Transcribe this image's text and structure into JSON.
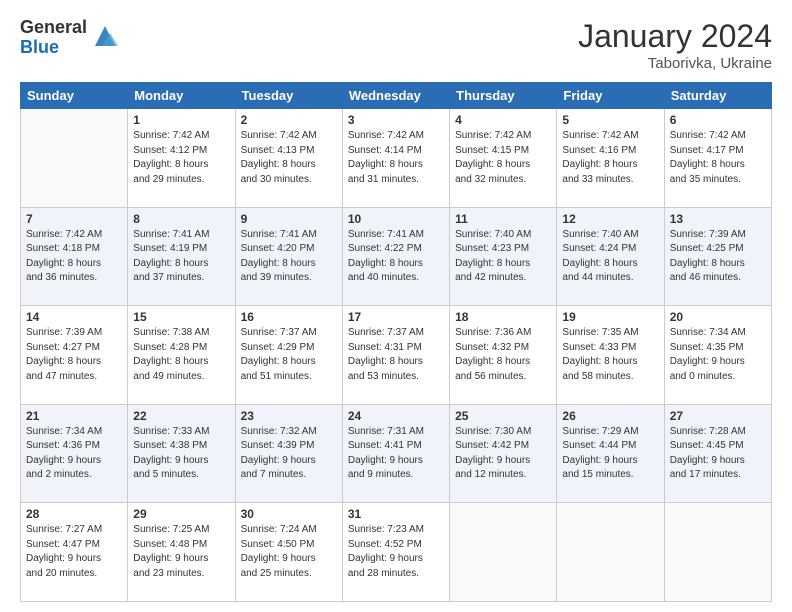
{
  "header": {
    "logo_general": "General",
    "logo_blue": "Blue",
    "month_year": "January 2024",
    "location": "Taborivka, Ukraine"
  },
  "columns": [
    "Sunday",
    "Monday",
    "Tuesday",
    "Wednesday",
    "Thursday",
    "Friday",
    "Saturday"
  ],
  "weeks": [
    {
      "shade": false,
      "days": [
        {
          "num": "",
          "info": ""
        },
        {
          "num": "1",
          "info": "Sunrise: 7:42 AM\nSunset: 4:12 PM\nDaylight: 8 hours\nand 29 minutes."
        },
        {
          "num": "2",
          "info": "Sunrise: 7:42 AM\nSunset: 4:13 PM\nDaylight: 8 hours\nand 30 minutes."
        },
        {
          "num": "3",
          "info": "Sunrise: 7:42 AM\nSunset: 4:14 PM\nDaylight: 8 hours\nand 31 minutes."
        },
        {
          "num": "4",
          "info": "Sunrise: 7:42 AM\nSunset: 4:15 PM\nDaylight: 8 hours\nand 32 minutes."
        },
        {
          "num": "5",
          "info": "Sunrise: 7:42 AM\nSunset: 4:16 PM\nDaylight: 8 hours\nand 33 minutes."
        },
        {
          "num": "6",
          "info": "Sunrise: 7:42 AM\nSunset: 4:17 PM\nDaylight: 8 hours\nand 35 minutes."
        }
      ]
    },
    {
      "shade": true,
      "days": [
        {
          "num": "7",
          "info": "Sunrise: 7:42 AM\nSunset: 4:18 PM\nDaylight: 8 hours\nand 36 minutes."
        },
        {
          "num": "8",
          "info": "Sunrise: 7:41 AM\nSunset: 4:19 PM\nDaylight: 8 hours\nand 37 minutes."
        },
        {
          "num": "9",
          "info": "Sunrise: 7:41 AM\nSunset: 4:20 PM\nDaylight: 8 hours\nand 39 minutes."
        },
        {
          "num": "10",
          "info": "Sunrise: 7:41 AM\nSunset: 4:22 PM\nDaylight: 8 hours\nand 40 minutes."
        },
        {
          "num": "11",
          "info": "Sunrise: 7:40 AM\nSunset: 4:23 PM\nDaylight: 8 hours\nand 42 minutes."
        },
        {
          "num": "12",
          "info": "Sunrise: 7:40 AM\nSunset: 4:24 PM\nDaylight: 8 hours\nand 44 minutes."
        },
        {
          "num": "13",
          "info": "Sunrise: 7:39 AM\nSunset: 4:25 PM\nDaylight: 8 hours\nand 46 minutes."
        }
      ]
    },
    {
      "shade": false,
      "days": [
        {
          "num": "14",
          "info": "Sunrise: 7:39 AM\nSunset: 4:27 PM\nDaylight: 8 hours\nand 47 minutes."
        },
        {
          "num": "15",
          "info": "Sunrise: 7:38 AM\nSunset: 4:28 PM\nDaylight: 8 hours\nand 49 minutes."
        },
        {
          "num": "16",
          "info": "Sunrise: 7:37 AM\nSunset: 4:29 PM\nDaylight: 8 hours\nand 51 minutes."
        },
        {
          "num": "17",
          "info": "Sunrise: 7:37 AM\nSunset: 4:31 PM\nDaylight: 8 hours\nand 53 minutes."
        },
        {
          "num": "18",
          "info": "Sunrise: 7:36 AM\nSunset: 4:32 PM\nDaylight: 8 hours\nand 56 minutes."
        },
        {
          "num": "19",
          "info": "Sunrise: 7:35 AM\nSunset: 4:33 PM\nDaylight: 8 hours\nand 58 minutes."
        },
        {
          "num": "20",
          "info": "Sunrise: 7:34 AM\nSunset: 4:35 PM\nDaylight: 9 hours\nand 0 minutes."
        }
      ]
    },
    {
      "shade": true,
      "days": [
        {
          "num": "21",
          "info": "Sunrise: 7:34 AM\nSunset: 4:36 PM\nDaylight: 9 hours\nand 2 minutes."
        },
        {
          "num": "22",
          "info": "Sunrise: 7:33 AM\nSunset: 4:38 PM\nDaylight: 9 hours\nand 5 minutes."
        },
        {
          "num": "23",
          "info": "Sunrise: 7:32 AM\nSunset: 4:39 PM\nDaylight: 9 hours\nand 7 minutes."
        },
        {
          "num": "24",
          "info": "Sunrise: 7:31 AM\nSunset: 4:41 PM\nDaylight: 9 hours\nand 9 minutes."
        },
        {
          "num": "25",
          "info": "Sunrise: 7:30 AM\nSunset: 4:42 PM\nDaylight: 9 hours\nand 12 minutes."
        },
        {
          "num": "26",
          "info": "Sunrise: 7:29 AM\nSunset: 4:44 PM\nDaylight: 9 hours\nand 15 minutes."
        },
        {
          "num": "27",
          "info": "Sunrise: 7:28 AM\nSunset: 4:45 PM\nDaylight: 9 hours\nand 17 minutes."
        }
      ]
    },
    {
      "shade": false,
      "days": [
        {
          "num": "28",
          "info": "Sunrise: 7:27 AM\nSunset: 4:47 PM\nDaylight: 9 hours\nand 20 minutes."
        },
        {
          "num": "29",
          "info": "Sunrise: 7:25 AM\nSunset: 4:48 PM\nDaylight: 9 hours\nand 23 minutes."
        },
        {
          "num": "30",
          "info": "Sunrise: 7:24 AM\nSunset: 4:50 PM\nDaylight: 9 hours\nand 25 minutes."
        },
        {
          "num": "31",
          "info": "Sunrise: 7:23 AM\nSunset: 4:52 PM\nDaylight: 9 hours\nand 28 minutes."
        },
        {
          "num": "",
          "info": ""
        },
        {
          "num": "",
          "info": ""
        },
        {
          "num": "",
          "info": ""
        }
      ]
    }
  ]
}
